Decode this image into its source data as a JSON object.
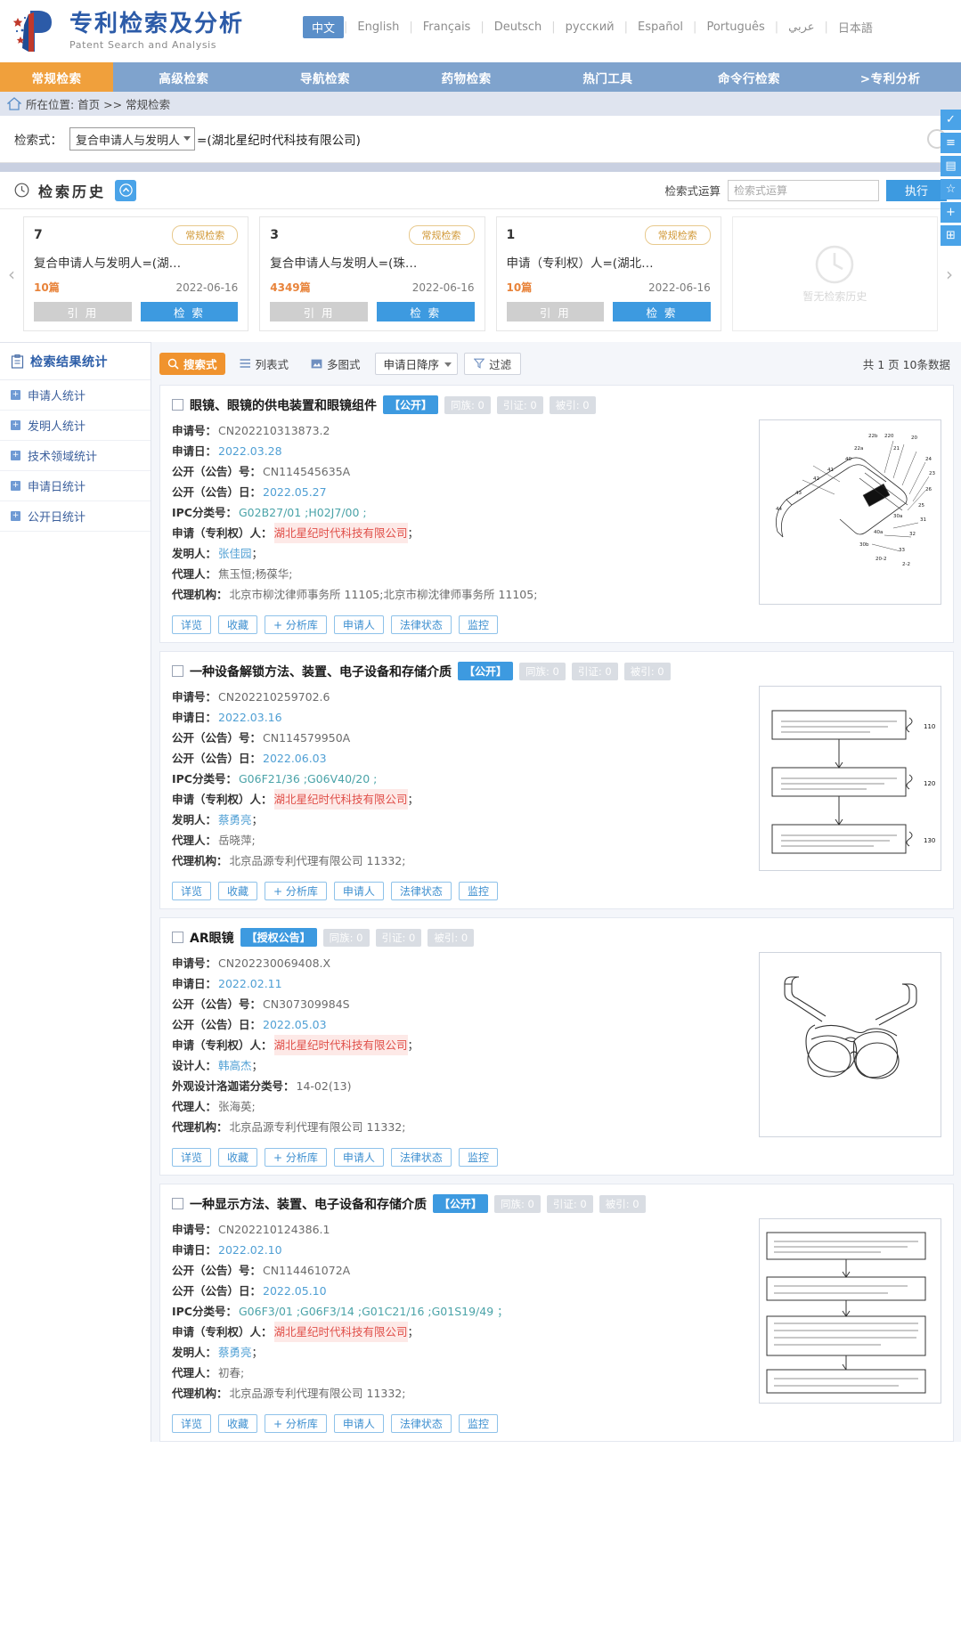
{
  "header": {
    "title_cn": "专利检索及分析",
    "title_en": "Patent Search and Analysis",
    "languages": [
      {
        "label": "中文",
        "active": true
      },
      {
        "label": "English",
        "active": false
      },
      {
        "label": "Français",
        "active": false
      },
      {
        "label": "Deutsch",
        "active": false
      },
      {
        "label": "русский",
        "active": false
      },
      {
        "label": "Español",
        "active": false
      },
      {
        "label": "Português",
        "active": false
      },
      {
        "label": "عربي",
        "active": false
      },
      {
        "label": "日本語",
        "active": false
      }
    ]
  },
  "nav": {
    "items": [
      {
        "label": "常规检索",
        "active": true
      },
      {
        "label": "高级检索",
        "active": false
      },
      {
        "label": "导航检索",
        "active": false
      },
      {
        "label": "药物检索",
        "active": false
      },
      {
        "label": "热门工具",
        "active": false
      },
      {
        "label": "命令行检索",
        "active": false
      },
      {
        "label": ">专利分析",
        "active": false
      }
    ]
  },
  "breadcrumb": {
    "text": "所在位置: 首页 >> 常规检索"
  },
  "searchbar": {
    "label": "检索式：",
    "field_select": "复合申请人与发明人",
    "query": "=(湖北星纪时代科技有限公司)"
  },
  "history": {
    "title": "检索历史",
    "operation_label": "检索式运算",
    "operation_placeholder": "检索式运算",
    "execute_label": "执行",
    "cards": [
      {
        "num": "7",
        "tag": "常规检索",
        "query": "复合申请人与发明人=(湖…",
        "count": "10篇",
        "date": "2022-06-16",
        "cite_label": "引 用",
        "search_label": "检 索"
      },
      {
        "num": "3",
        "tag": "常规检索",
        "query": "复合申请人与发明人=(珠…",
        "count": "4349篇",
        "date": "2022-06-16",
        "cite_label": "引 用",
        "search_label": "检 索"
      },
      {
        "num": "1",
        "tag": "常规检索",
        "query": "申请（专利权）人=(湖北…",
        "count": "10篇",
        "date": "2022-06-16",
        "cite_label": "引 用",
        "search_label": "检 索"
      }
    ],
    "empty_card_text": "暂无检索历史"
  },
  "sidebar": {
    "title": "检索结果统计",
    "items": [
      {
        "label": "申请人统计"
      },
      {
        "label": "发明人统计"
      },
      {
        "label": "技术领域统计"
      },
      {
        "label": "申请日统计"
      },
      {
        "label": "公开日统计"
      }
    ]
  },
  "toolbar": {
    "view_expression": "搜索式",
    "view_list": "列表式",
    "view_grid": "多图式",
    "sort": "申请日降序",
    "filter": "过滤",
    "count_text": "共 1 页 10条数据"
  },
  "labels": {
    "app_no": "申请号：",
    "app_date": "申请日：",
    "pub_no": "公开（公告）号：",
    "pub_date": "公开（公告）日：",
    "ipc": "IPC分类号：",
    "applicant": "申请（专利权）人：",
    "inventor": "发明人：",
    "designer": "设计人：",
    "locarno": "外观设计洛迦诺分类号：",
    "agent": "代理人：",
    "agency": "代理机构："
  },
  "actions": {
    "detail": "详览",
    "collect": "收藏",
    "add_lib": "+ 分析库",
    "applicant": "申请人",
    "legal": "法律状态",
    "monitor": "监控"
  },
  "badges": {
    "family": "同族:",
    "citation": "引证:",
    "cited": "被引:"
  },
  "results": [
    {
      "title": "眼镜、眼镜的供电装置和眼镜组件",
      "status": "【公开】",
      "family": "0",
      "citation": "0",
      "cited": "0",
      "app_no": "CN202210313873.2",
      "app_date": "2022.03.28",
      "pub_no": "CN114545635A",
      "pub_date": "2022.05.27",
      "ipc": "G02B27/01 ;H02J7/00 ;",
      "applicant": "湖北星纪时代科技有限公司",
      "inventor": "张佳园",
      "agent": "焦玉恒;杨葆华;",
      "agency": "北京市柳沈律师事务所 11105;北京市柳沈律师事务所 11105;",
      "figure": "glasses-assembly"
    },
    {
      "title": "一种设备解锁方法、装置、电子设备和存储介质",
      "status": "【公开】",
      "family": "0",
      "citation": "0",
      "cited": "0",
      "app_no": "CN202210259702.6",
      "app_date": "2022.03.16",
      "pub_no": "CN114579950A",
      "pub_date": "2022.06.03",
      "ipc": "G06F21/36 ;G06V40/20 ;",
      "applicant": "湖北星纪时代科技有限公司",
      "inventor": "蔡勇亮",
      "agent": "岳晓萍;",
      "agency": "北京品源专利代理有限公司 11332;",
      "figure": "flowchart3"
    },
    {
      "title": "AR眼镜",
      "status": "【授权公告】",
      "family": "0",
      "citation": "0",
      "cited": "0",
      "app_no": "CN202230069408.X",
      "app_date": "2022.02.11",
      "pub_no": "CN307309984S",
      "pub_date": "2022.05.03",
      "applicant": "湖北星纪时代科技有限公司",
      "designer": "韩高杰",
      "locarno": "14-02(13)",
      "agent": "张海英;",
      "agency": "北京品源专利代理有限公司 11332;",
      "figure": "ar-glasses"
    },
    {
      "title": "一种显示方法、装置、电子设备和存储介质",
      "status": "【公开】",
      "family": "0",
      "citation": "0",
      "cited": "0",
      "app_no": "CN202210124386.1",
      "app_date": "2022.02.10",
      "pub_no": "CN114461072A",
      "pub_date": "2022.05.10",
      "ipc": "G06F3/01 ;G06F3/14 ;G01C21/16 ;G01S19/49 ；",
      "applicant": "湖北星纪时代科技有限公司",
      "inventor": "蔡勇亮",
      "agent": "初春;",
      "agency": "北京品源专利代理有限公司 11332;",
      "figure": "flowchart4"
    }
  ],
  "rail": {
    "items": [
      "✓",
      "≡",
      "▤",
      "☆",
      "+",
      "⊞"
    ]
  }
}
